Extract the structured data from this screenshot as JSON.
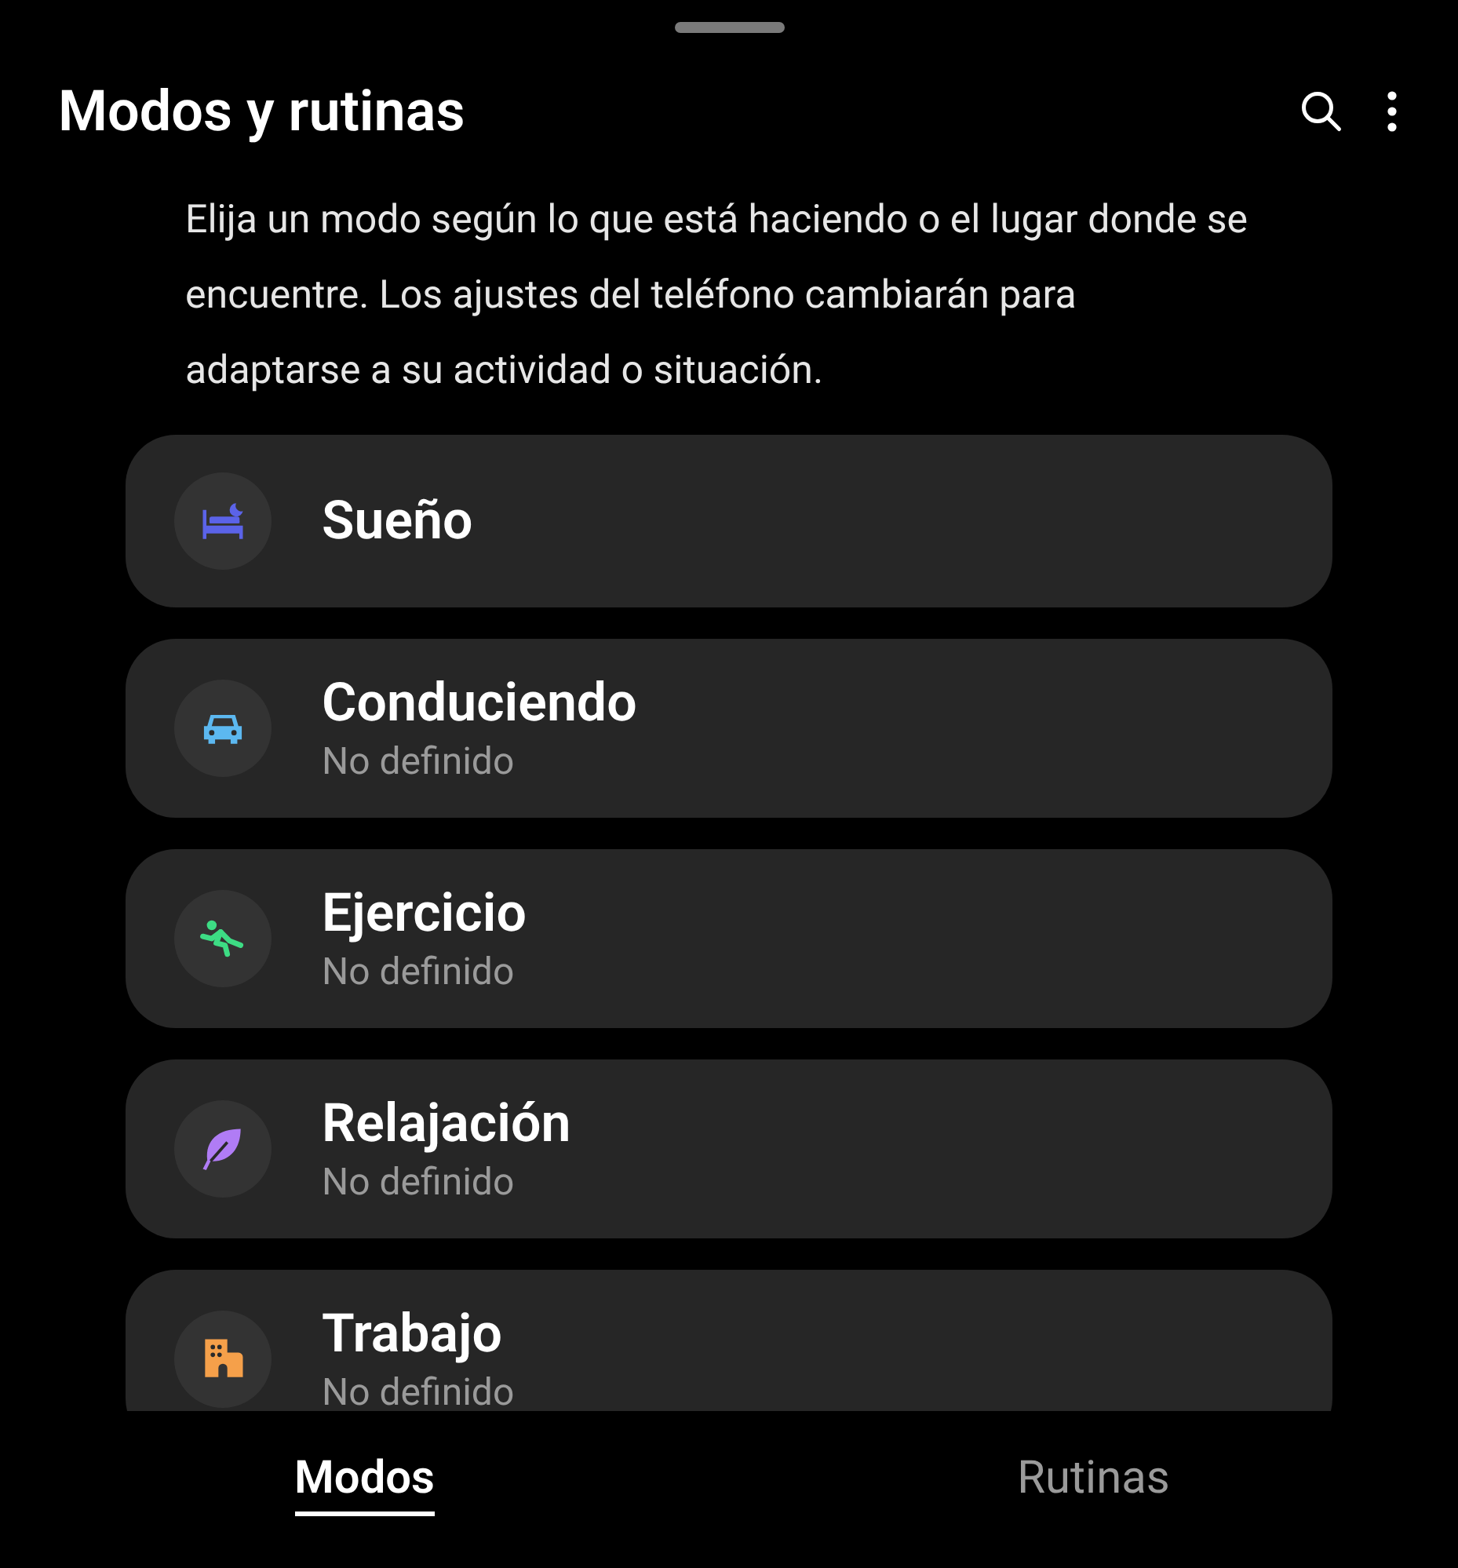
{
  "header": {
    "title": "Modos y rutinas"
  },
  "description": "Elija un modo según lo que está haciendo o el lugar donde se encuentre. Los ajustes del teléfono cambiarán para adaptarse a su actividad o situación.",
  "modes": [
    {
      "kind": "sleep",
      "title": "Sueño",
      "color": "#5b63e8"
    },
    {
      "kind": "driving",
      "title": "Conduciendo",
      "subtitle": "No definido",
      "color": "#5cb8f0"
    },
    {
      "kind": "exercise",
      "title": "Ejercicio",
      "subtitle": "No definido",
      "color": "#3ddc84"
    },
    {
      "kind": "relax",
      "title": "Relajación",
      "subtitle": "No definido",
      "color": "#b07cf5"
    },
    {
      "kind": "work",
      "title": "Trabajo",
      "subtitle": "No definido",
      "color": "#f5a04a"
    }
  ],
  "tabs": [
    {
      "label": "Modos",
      "selected": true
    },
    {
      "label": "Rutinas",
      "selected": false
    }
  ]
}
